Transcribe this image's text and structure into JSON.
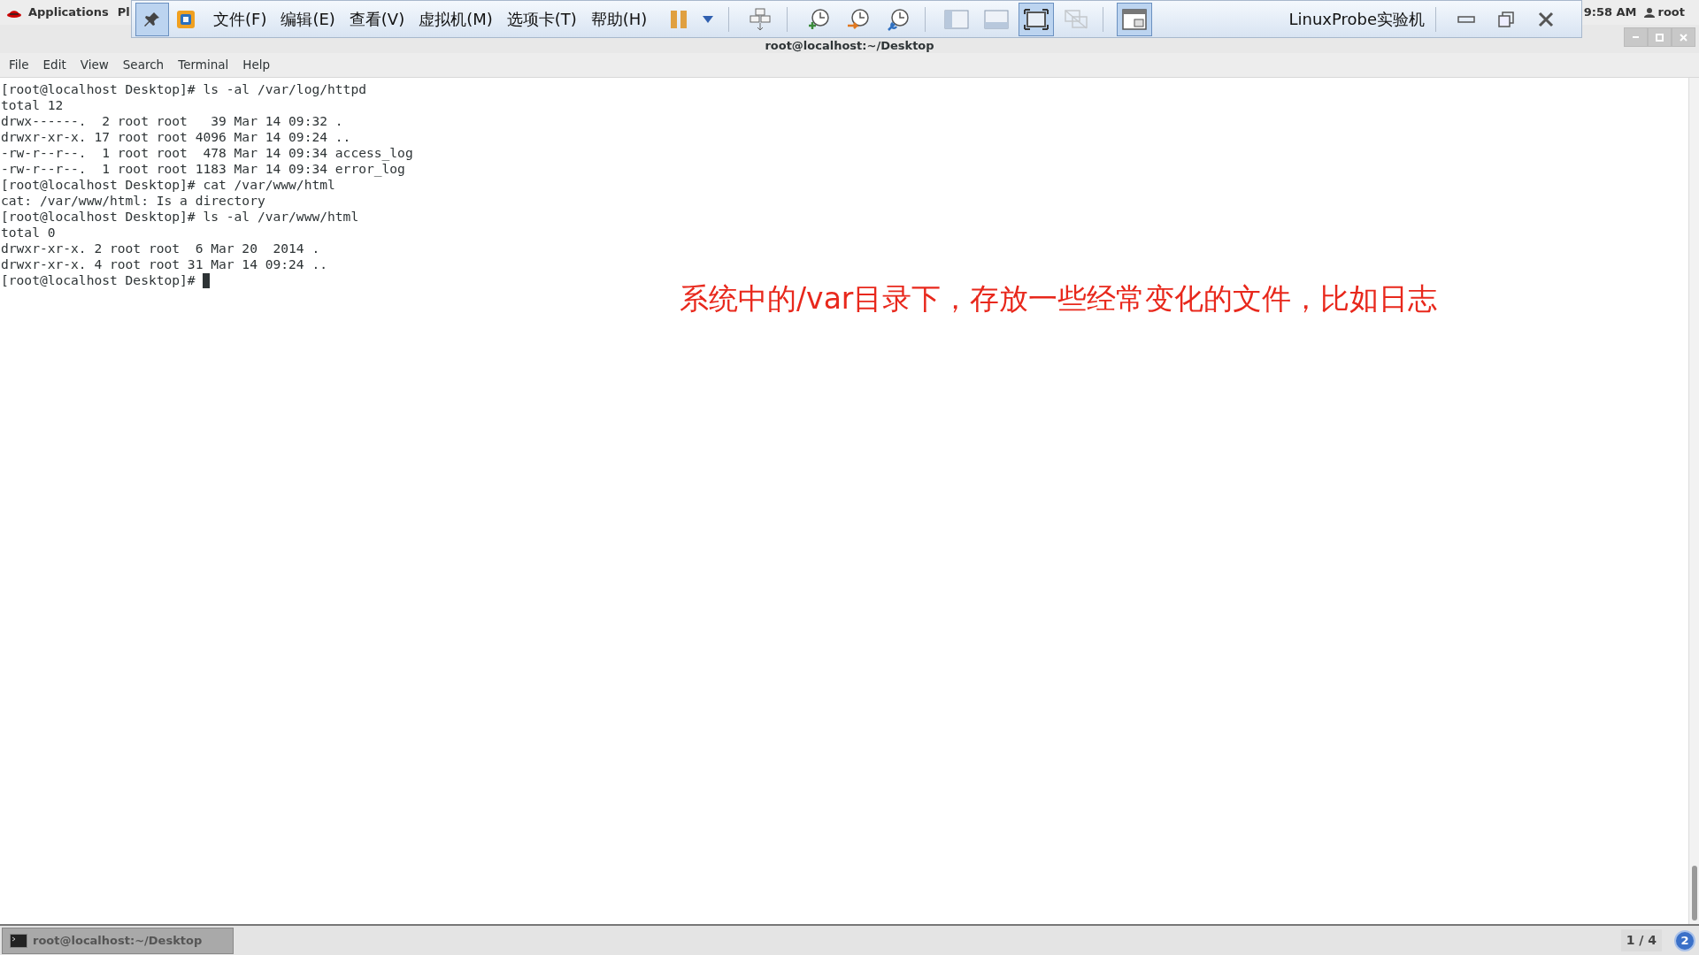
{
  "top_bar": {
    "applications": "Applications",
    "places": "Pl",
    "clock": "9:58 AM",
    "user": "root"
  },
  "vm_toolbar": {
    "pin": {
      "selected": true
    },
    "menus": [
      "文件(F)",
      "编辑(E)",
      "查看(V)",
      "虚拟机(M)",
      "选项卡(T)",
      "帮助(H)"
    ],
    "tools": [
      {
        "kind": "pause",
        "selected": false
      },
      {
        "kind": "dropdown",
        "selected": false
      },
      {
        "kind": "sep"
      },
      {
        "kind": "keys",
        "selected": false
      },
      {
        "kind": "sep"
      },
      {
        "kind": "snapshot",
        "selected": false
      },
      {
        "kind": "revert",
        "selected": false
      },
      {
        "kind": "manager",
        "selected": false
      },
      {
        "kind": "sep"
      },
      {
        "kind": "sidebar",
        "selected": false
      },
      {
        "kind": "console",
        "selected": false
      },
      {
        "kind": "fullscreen",
        "selected": true
      },
      {
        "kind": "unity",
        "selected": false
      },
      {
        "kind": "sep"
      },
      {
        "kind": "thumbnail",
        "selected": true
      }
    ],
    "title": "LinuxProbe实验机"
  },
  "terminal": {
    "title": "root@localhost:~/Desktop",
    "menus": [
      "File",
      "Edit",
      "View",
      "Search",
      "Terminal",
      "Help"
    ],
    "lines": [
      "[root@localhost Desktop]# ls -al /var/log/httpd",
      "total 12",
      "drwx------.  2 root root   39 Mar 14 09:32 .",
      "drwxr-xr-x. 17 root root 4096 Mar 14 09:24 ..",
      "-rw-r--r--.  1 root root  478 Mar 14 09:34 access_log",
      "-rw-r--r--.  1 root root 1183 Mar 14 09:34 error_log",
      "[root@localhost Desktop]# cat /var/www/html",
      "cat: /var/www/html: Is a directory",
      "[root@localhost Desktop]# ls -al /var/www/html",
      "total 0",
      "drwxr-xr-x. 2 root root  6 Mar 20  2014 .",
      "drwxr-xr-x. 4 root root 31 Mar 14 09:24 ..",
      "[root@localhost Desktop]# "
    ],
    "cursor": true
  },
  "annotation": "系统中的/var目录下，存放一些经常变化的文件，比如日志",
  "taskbar": {
    "items": [
      {
        "label": "root@localhost:~/Desktop",
        "selected": true
      }
    ],
    "workspace": "1 / 4",
    "badge": "2"
  }
}
